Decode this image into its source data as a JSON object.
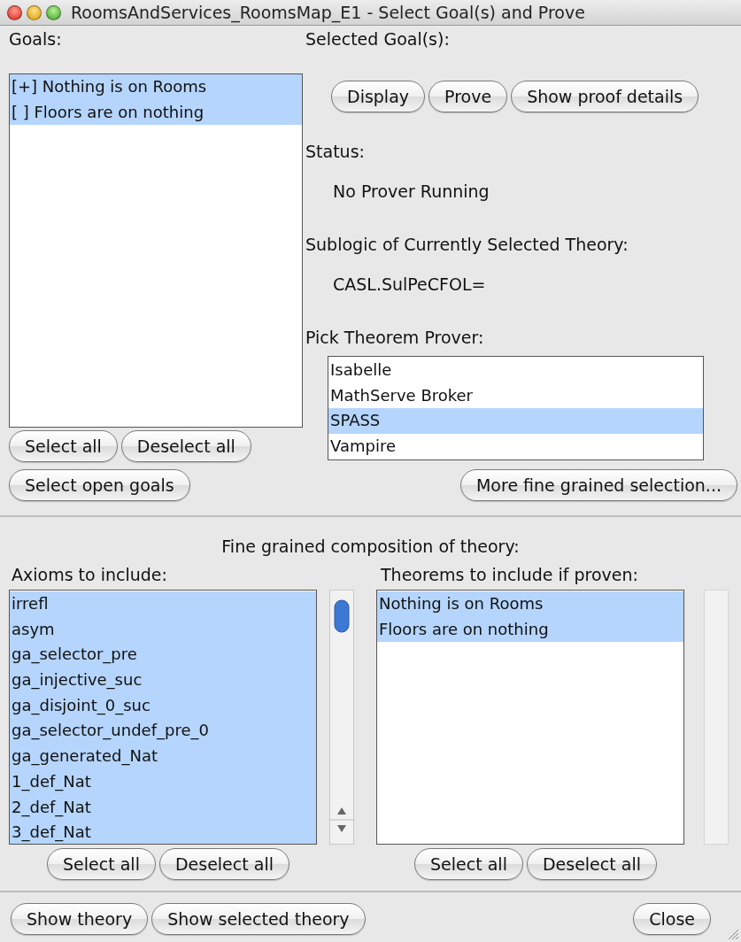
{
  "window": {
    "title": "RoomsAndServices_RoomsMap_E1 - Select Goal(s) and Prove"
  },
  "goals": {
    "label": "Goals:",
    "items": [
      {
        "text": "[+] Nothing is on Rooms",
        "selected": true
      },
      {
        "text": "[ ] Floors are on nothing",
        "selected": true
      }
    ],
    "buttons": [
      "Select all",
      "Deselect all",
      "Select open goals"
    ]
  },
  "selected_goals": {
    "label": "Selected Goal(s):",
    "buttons": [
      "Display",
      "Prove",
      "Show proof details"
    ]
  },
  "status": {
    "label": "Status:",
    "value": "No Prover Running"
  },
  "sublogic": {
    "label": "Sublogic of Currently Selected Theory:",
    "value": "CASL.SulPeCFOL="
  },
  "provers": {
    "label": "Pick Theorem Prover:",
    "items": [
      {
        "text": "Isabelle",
        "selected": false
      },
      {
        "text": "MathServe Broker",
        "selected": false
      },
      {
        "text": "SPASS",
        "selected": true
      },
      {
        "text": "Vampire",
        "selected": false
      }
    ],
    "button": "More fine grained selection..."
  },
  "composition": {
    "title": "Fine grained composition of theory:",
    "axioms": {
      "label": "Axioms to include:",
      "items": [
        {
          "text": "irrefl",
          "selected": true
        },
        {
          "text": "asym",
          "selected": true
        },
        {
          "text": "ga_selector_pre",
          "selected": true
        },
        {
          "text": "ga_injective_suc",
          "selected": true
        },
        {
          "text": "ga_disjoint_0_suc",
          "selected": true
        },
        {
          "text": "ga_selector_undef_pre_0",
          "selected": true
        },
        {
          "text": "ga_generated_Nat",
          "selected": true
        },
        {
          "text": "1_def_Nat",
          "selected": true
        },
        {
          "text": "2_def_Nat",
          "selected": true
        },
        {
          "text": "3_def_Nat",
          "selected": true
        }
      ],
      "buttons": [
        "Select all",
        "Deselect all"
      ]
    },
    "theorems": {
      "label": "Theorems to include if proven:",
      "items": [
        {
          "text": "Nothing is on Rooms",
          "selected": true
        },
        {
          "text": "Floors are on nothing",
          "selected": true
        }
      ],
      "buttons": [
        "Select all",
        "Deselect all"
      ]
    }
  },
  "footer": {
    "left_buttons": [
      "Show theory",
      "Show selected theory"
    ],
    "right_button": "Close"
  }
}
